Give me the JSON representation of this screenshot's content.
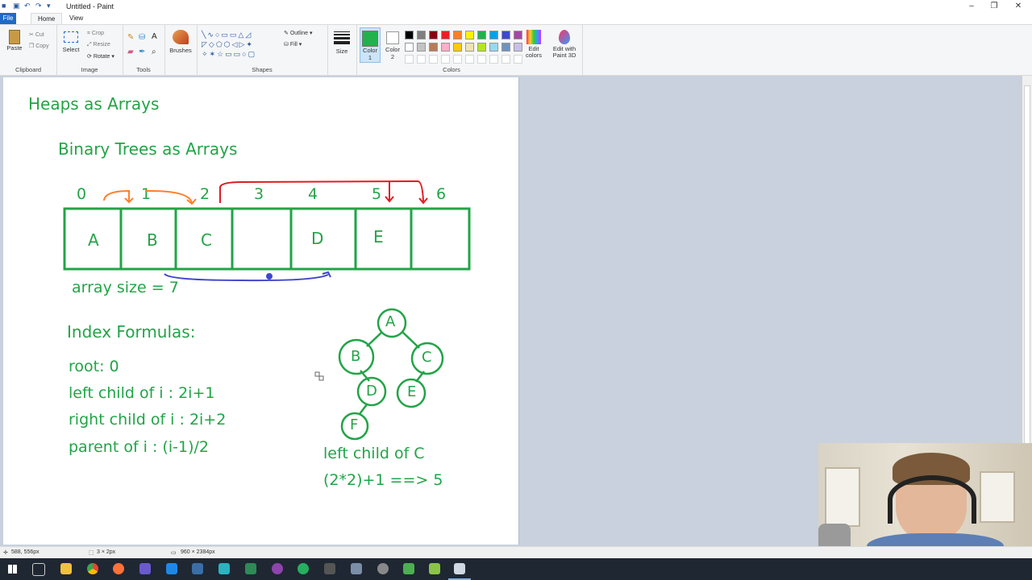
{
  "window": {
    "title": "Untitled - Paint",
    "controls": [
      "–",
      "❐",
      "✕"
    ]
  },
  "tabs": [
    "File",
    "Home",
    "View"
  ],
  "ribbon": {
    "clipboard": {
      "label": "Clipboard",
      "paste": "Paste",
      "cut": "Cut",
      "copy": "Copy"
    },
    "image": {
      "label": "Image",
      "select": "Select",
      "crop": "Crop",
      "resize": "Resize",
      "rotate": "Rotate"
    },
    "tools": {
      "label": "Tools"
    },
    "brushes": {
      "label": "Brushes"
    },
    "shapes": {
      "label": "Shapes",
      "outline": "Outline",
      "fill": "Fill"
    },
    "size": {
      "label": "Size"
    },
    "color1": {
      "label": "Color",
      "sub": "1"
    },
    "color2": {
      "label": "Color",
      "sub": "2"
    },
    "colors": {
      "label": "Colors",
      "edit": "Edit colors",
      "edit_paint3d": "Edit with Paint 3D"
    },
    "palette_row1": [
      "#000000",
      "#7f7f7f",
      "#880015",
      "#ed1c24",
      "#ff7f27",
      "#fff200",
      "#22b14c",
      "#00a2e8",
      "#3f48cc",
      "#a349a4"
    ],
    "palette_row2": [
      "#ffffff",
      "#c3c3c3",
      "#b97a57",
      "#ffaec9",
      "#ffc90e",
      "#efe4b0",
      "#b5e61d",
      "#99d9ea",
      "#7092be",
      "#c8bfe7"
    ],
    "color1_value": "#22b14c",
    "color2_value": "#ffffff"
  },
  "drawing": {
    "heading": "Heaps as Arrays",
    "subheading": "Binary Trees as Arrays",
    "indices": [
      "0",
      "1",
      "2",
      "3",
      "4",
      "5",
      "6"
    ],
    "cells": [
      "A",
      "B",
      "C",
      "",
      "D",
      "E",
      ""
    ],
    "array_size": "array size = 7",
    "formulas_title": "Index Formulas:",
    "formulas": [
      "root: 0",
      "left child of i : 2i+1",
      "right child of i : 2i+2",
      "parent of i : (i-1)/2"
    ],
    "tree_nodes": [
      "A",
      "B",
      "C",
      "D",
      "E",
      "F"
    ],
    "example_line1": "left child of C",
    "example_line2": "(2*2)+1 ==> 5"
  },
  "status": {
    "cursor": "588, 556px",
    "selection": "3 × 2px",
    "canvas_size": "960 × 2384px"
  }
}
